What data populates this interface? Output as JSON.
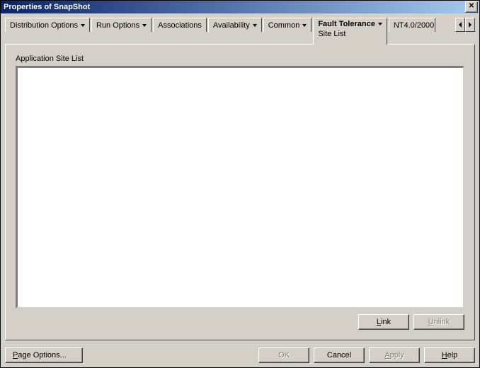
{
  "window": {
    "title": "Properties of SnapShot",
    "close_glyph": "✕"
  },
  "tabs": {
    "items": [
      {
        "label": "Distribution Options",
        "has_menu": true
      },
      {
        "label": "Run Options",
        "has_menu": true
      },
      {
        "label": "Associations",
        "has_menu": false
      },
      {
        "label": "Availability",
        "has_menu": true
      },
      {
        "label": "Common",
        "has_menu": true
      },
      {
        "label": "Fault Tolerance",
        "has_menu": true,
        "sub": "Site List"
      },
      {
        "label": "NT4.0/2000",
        "has_menu": false
      }
    ],
    "active_index": 5
  },
  "content": {
    "section_label": "Application Site List"
  },
  "list_actions": {
    "link": "Link",
    "unlink": "Unlink"
  },
  "footer": {
    "page_options": "Page Options...",
    "ok": "OK",
    "cancel": "Cancel",
    "apply": "Apply",
    "help": "Help"
  }
}
